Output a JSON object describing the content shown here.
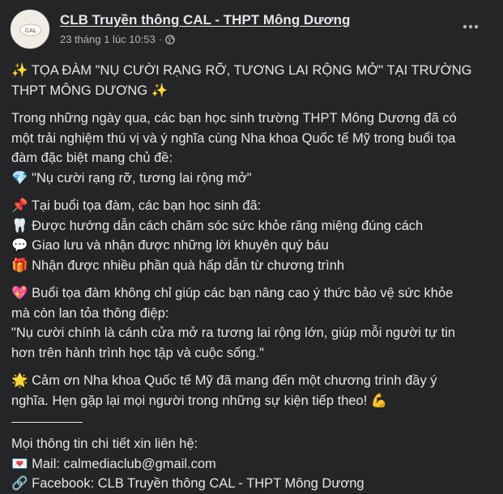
{
  "post": {
    "page_name": "CLB Truyền thông CAL - THPT Mông Dương",
    "timestamp": "23 tháng 1 lúc 10:53",
    "privacy_icon": "globe-icon",
    "more_icon": "more-horizontal-icon",
    "avatar_text": "CAL"
  },
  "body": {
    "title_line1": "✨ TỌA ĐÀM \"NỤ CƯỜI RẠNG RỠ, TƯƠNG LAI RỘNG MỞ\" TẠI TRƯỜNG",
    "title_line2": "THPT MÔNG DƯƠNG ✨",
    "intro_line1": " Trong những ngày qua, các bạn học sinh trường THPT Mông Dương đã có",
    "intro_line2": "một trải nghiệm thú vị và ý nghĩa cùng Nha khoa Quốc tế Mỹ trong buổi tọa",
    "intro_line3": "đàm đặc biệt mang chủ đề:",
    "theme_line": "💎 \"Nụ cười rạng rỡ, tương lai rộng mở\"",
    "activities_head": "📌 Tại buổi tọa đàm, các bạn học sinh đã:",
    "activity1": "🦷 Được hướng dẫn cách chăm sóc sức khỏe răng miệng đúng cách",
    "activity2": "💬 Giao lưu và nhận được những lời khuyên quý báu",
    "activity3": "🎁 Nhận được nhiều phần quà hấp dẫn từ chương trình",
    "msg_line1": "💖 Buổi tọa đàm không chỉ giúp các bạn nâng cao ý thức bảo vệ sức khỏe",
    "msg_line2": "mà còn lan tỏa thông điệp:",
    "quote_line1": "\"Nụ cười chính là cánh cửa mở ra tương lai rộng lớn, giúp mỗi người tự tin",
    "quote_line2": "hơn trên hành trình học tập và cuộc sống.\"",
    "thanks_line1": "🌟 Cảm ơn Nha khoa Quốc tế Mỹ đã mang đến một chương trình đầy ý",
    "thanks_line2": "nghĩa. Hẹn gặp lại mọi người trong những sự kiện tiếp theo! 💪",
    "contact_head": "Mọi thông tin chi tiết xin liên hệ:",
    "contact_mail": "💌 Mail: calmediaclub@gmail.com",
    "contact_fb": "🔗 Facebook: CLB Truyền thông CAL - THPT Mông Dương"
  }
}
